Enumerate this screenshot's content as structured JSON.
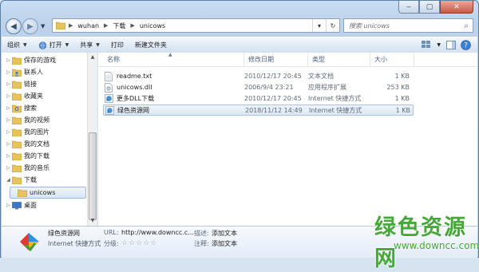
{
  "window": {
    "caption_buttons": {
      "minimize": "‒",
      "maximize": "▢",
      "close": "✕"
    }
  },
  "address_bar": {
    "crumbs": [
      "wuhan",
      "下载",
      "unicows"
    ],
    "refresh_icon": "↻"
  },
  "search": {
    "placeholder": "搜索 unicows"
  },
  "toolbar": {
    "organize": "组织",
    "open": "打开",
    "share": "共享",
    "print": "打印",
    "new_folder": "新建文件夹"
  },
  "nav_pane": {
    "items": [
      {
        "label": "保存的游戏",
        "icon": "folder-icon"
      },
      {
        "label": "联系人",
        "icon": "contacts-icon"
      },
      {
        "label": "链接",
        "icon": "folder-icon"
      },
      {
        "label": "收藏夹",
        "icon": "folder-icon"
      },
      {
        "label": "搜索",
        "icon": "search-folder-icon"
      },
      {
        "label": "我的视频",
        "icon": "folder-icon"
      },
      {
        "label": "我的图片",
        "icon": "folder-icon"
      },
      {
        "label": "我的文档",
        "icon": "folder-icon"
      },
      {
        "label": "我的下载",
        "icon": "folder-icon"
      },
      {
        "label": "我的音乐",
        "icon": "folder-icon"
      },
      {
        "label": "下载",
        "icon": "folder-icon"
      },
      {
        "label": "unicows",
        "icon": "folder-icon",
        "selected": true
      },
      {
        "label": "桌面",
        "icon": "desktop-icon"
      }
    ]
  },
  "file_list": {
    "columns": {
      "name": "名称",
      "date": "修改日期",
      "type": "类型",
      "size": "大小"
    },
    "rows": [
      {
        "name": "readme.txt",
        "date": "2010/12/17 20:45",
        "type": "文本文档",
        "size": "1 KB",
        "icon": "text-file-icon"
      },
      {
        "name": "unicows.dll",
        "date": "2006/9/4 23:21",
        "type": "应用程序扩展",
        "size": "253 KB",
        "icon": "dll-file-icon"
      },
      {
        "name": "更多DLL下载",
        "date": "2010/12/17 20:45",
        "type": "Internet 快捷方式",
        "size": "1 KB",
        "icon": "internet-shortcut-icon"
      },
      {
        "name": "绿色资源网",
        "date": "2018/11/12 14:49",
        "type": "Internet 快捷方式",
        "size": "1 KB",
        "icon": "internet-shortcut-icon",
        "selected": true
      }
    ]
  },
  "details": {
    "name": "绿色资源网",
    "type": "Internet 快捷方式",
    "url_label": "URL:",
    "url_value": "http://www.downcc.c...",
    "rating_label": "分级:",
    "rating_stars": "☆☆☆☆☆",
    "desc_label": "描述:",
    "desc_value": "添加文本",
    "comment_label": "注释:",
    "comment_value": "添加文本"
  },
  "watermark": {
    "logo": "绿色资源网",
    "url": "www.downcc.com"
  }
}
